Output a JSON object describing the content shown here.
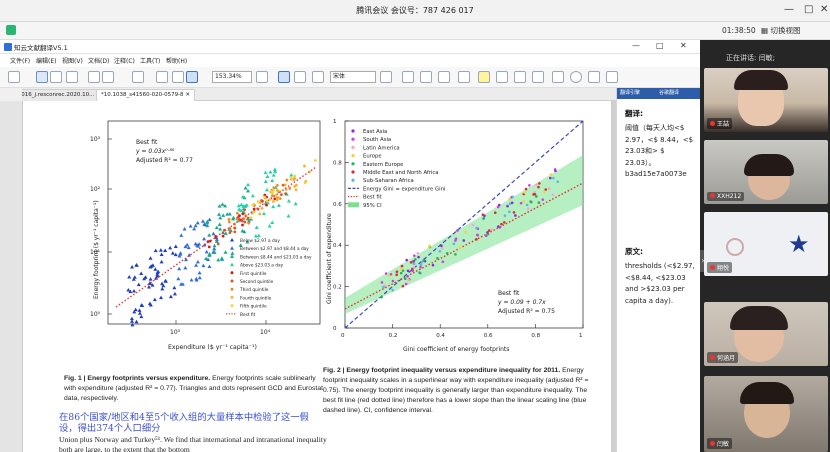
{
  "meeting": {
    "title": "腾讯会议 会议号：787 426 017",
    "timer": "01:38:50",
    "grid_view": "切换视图",
    "speaking": "正在讲话: 闫敏;"
  },
  "app": {
    "title": "知云文献翻译V5.1",
    "menus": [
      "文件(F)",
      "编辑(E)",
      "视图(V)",
      "文档(D)",
      "注释(C)",
      "工具(T)",
      "帮助(H)"
    ],
    "zoom": "153.34%",
    "font_select": "宋体",
    "tabs": [
      "10.1016_j.resconrec.2020.10...",
      "*10.1038_s41560-020-0579-8"
    ],
    "panel_tabs": [
      "翻译引擎",
      "谷歌翻译"
    ]
  },
  "figure1": {
    "ylabel": "Energy footprint ($ yr⁻¹ capita⁻¹)",
    "xlabel": "Expenditure ($ yr⁻¹ capita⁻¹)",
    "yticks": [
      "10³",
      "10²",
      "10¹",
      "10⁰"
    ],
    "xticks": [
      "10³",
      "10⁴"
    ],
    "bestfit_title": "Best fit",
    "bestfit_eq": "y = 0.03x⁰·⁸⁶",
    "bestfit_r2": "Adjusted R² = 0.77",
    "legend": [
      "Below $2.97 a day",
      "Between $2.97 and $8.44 a day",
      "Between $8.44 and $23.03 a day",
      "Above $23.03 a day",
      "First quintile",
      "Second quintile",
      "Third quintile",
      "Fourth quintile",
      "Fifth quintile",
      "Best fit"
    ],
    "caption_lead": "Fig. 1 | Energy footprints versus expenditure.",
    "caption_body": " Energy footprints scale sublinearly with expenditure (adjusted R² = 0.77). Triangles and dots represent GCD and Eurostat data, respectively."
  },
  "figure2": {
    "ylabel": "Gini coefficient of expenditure",
    "xlabel": "Gini coefficient of energy footprints",
    "xticks": [
      "0",
      "0.2",
      "0.4",
      "0.6",
      "0.8",
      "1"
    ],
    "yticks": [
      "0",
      "0.2",
      "0.4",
      "0.6",
      "0.8",
      "1"
    ],
    "legend": [
      "East Asia",
      "South Asia",
      "Latin America",
      "Europe",
      "Eastern Europe",
      "Middle East and North Africa",
      "Sub-Saharan Africa",
      "Energy Gini = expenditure Gini",
      "Best fit",
      "95% CI"
    ],
    "bestfit_title": "Best fit",
    "bestfit_eq": "y = 0.09 + 0.7x",
    "bestfit_r2": "Adjusted R² = 0.75",
    "caption_lead": "Fig. 2 | Energy footprint inequality versus expenditure inequality for 2011.",
    "caption_body": " Energy footprint inequality scales in a superlinear way with expenditure inequality (adjusted R² = 0.75). The energy footprint inequality is generally larger than expenditure inequality. The best fit line (red dotted line) therefore has a lower slope than the linear scaling line (blue dashed line). CI, confidence interval."
  },
  "doc": {
    "cn_note": "在86个国家/地区和4至5个收入组的大量样本中检验了这一假设，得出374个人口细分",
    "body": "Union plus Norway and Turkey⁵¹. We find that international and intranational inequality both are large, to the extent that the bottom"
  },
  "panel": {
    "translation_head": "翻译:",
    "translation_text": "阈值（每天人均<$ 2.97，<$ 8.44，<$ 23.03和>  $ 23.03）。b3ad15e7a0073e",
    "original_head": "原文:",
    "original_text": "thresholds (<$2.97, <$8.44, <$23.03 and >$23.03 per capita a day)."
  },
  "participants": [
    {
      "name": "王喆"
    },
    {
      "name": "XXH212"
    },
    {
      "name": "翔悦"
    },
    {
      "name": "何涵月"
    },
    {
      "name": "闫敏"
    }
  ],
  "colors": {
    "legend1": [
      "#1f3fbf",
      "#2f6ed8",
      "#18a88c",
      "#22d2a8",
      "#c81e1e",
      "#e0522a",
      "#f08a24",
      "#f2b42e",
      "#f7d23c",
      "#e03030"
    ],
    "legend2": [
      "#8a2bd6",
      "#cc3fe0",
      "#f2a6d6",
      "#f6d23a",
      "#2fae58",
      "#d43030",
      "#5db4e8",
      "#3b46c9",
      "#e03030",
      "#7ae28e"
    ]
  }
}
